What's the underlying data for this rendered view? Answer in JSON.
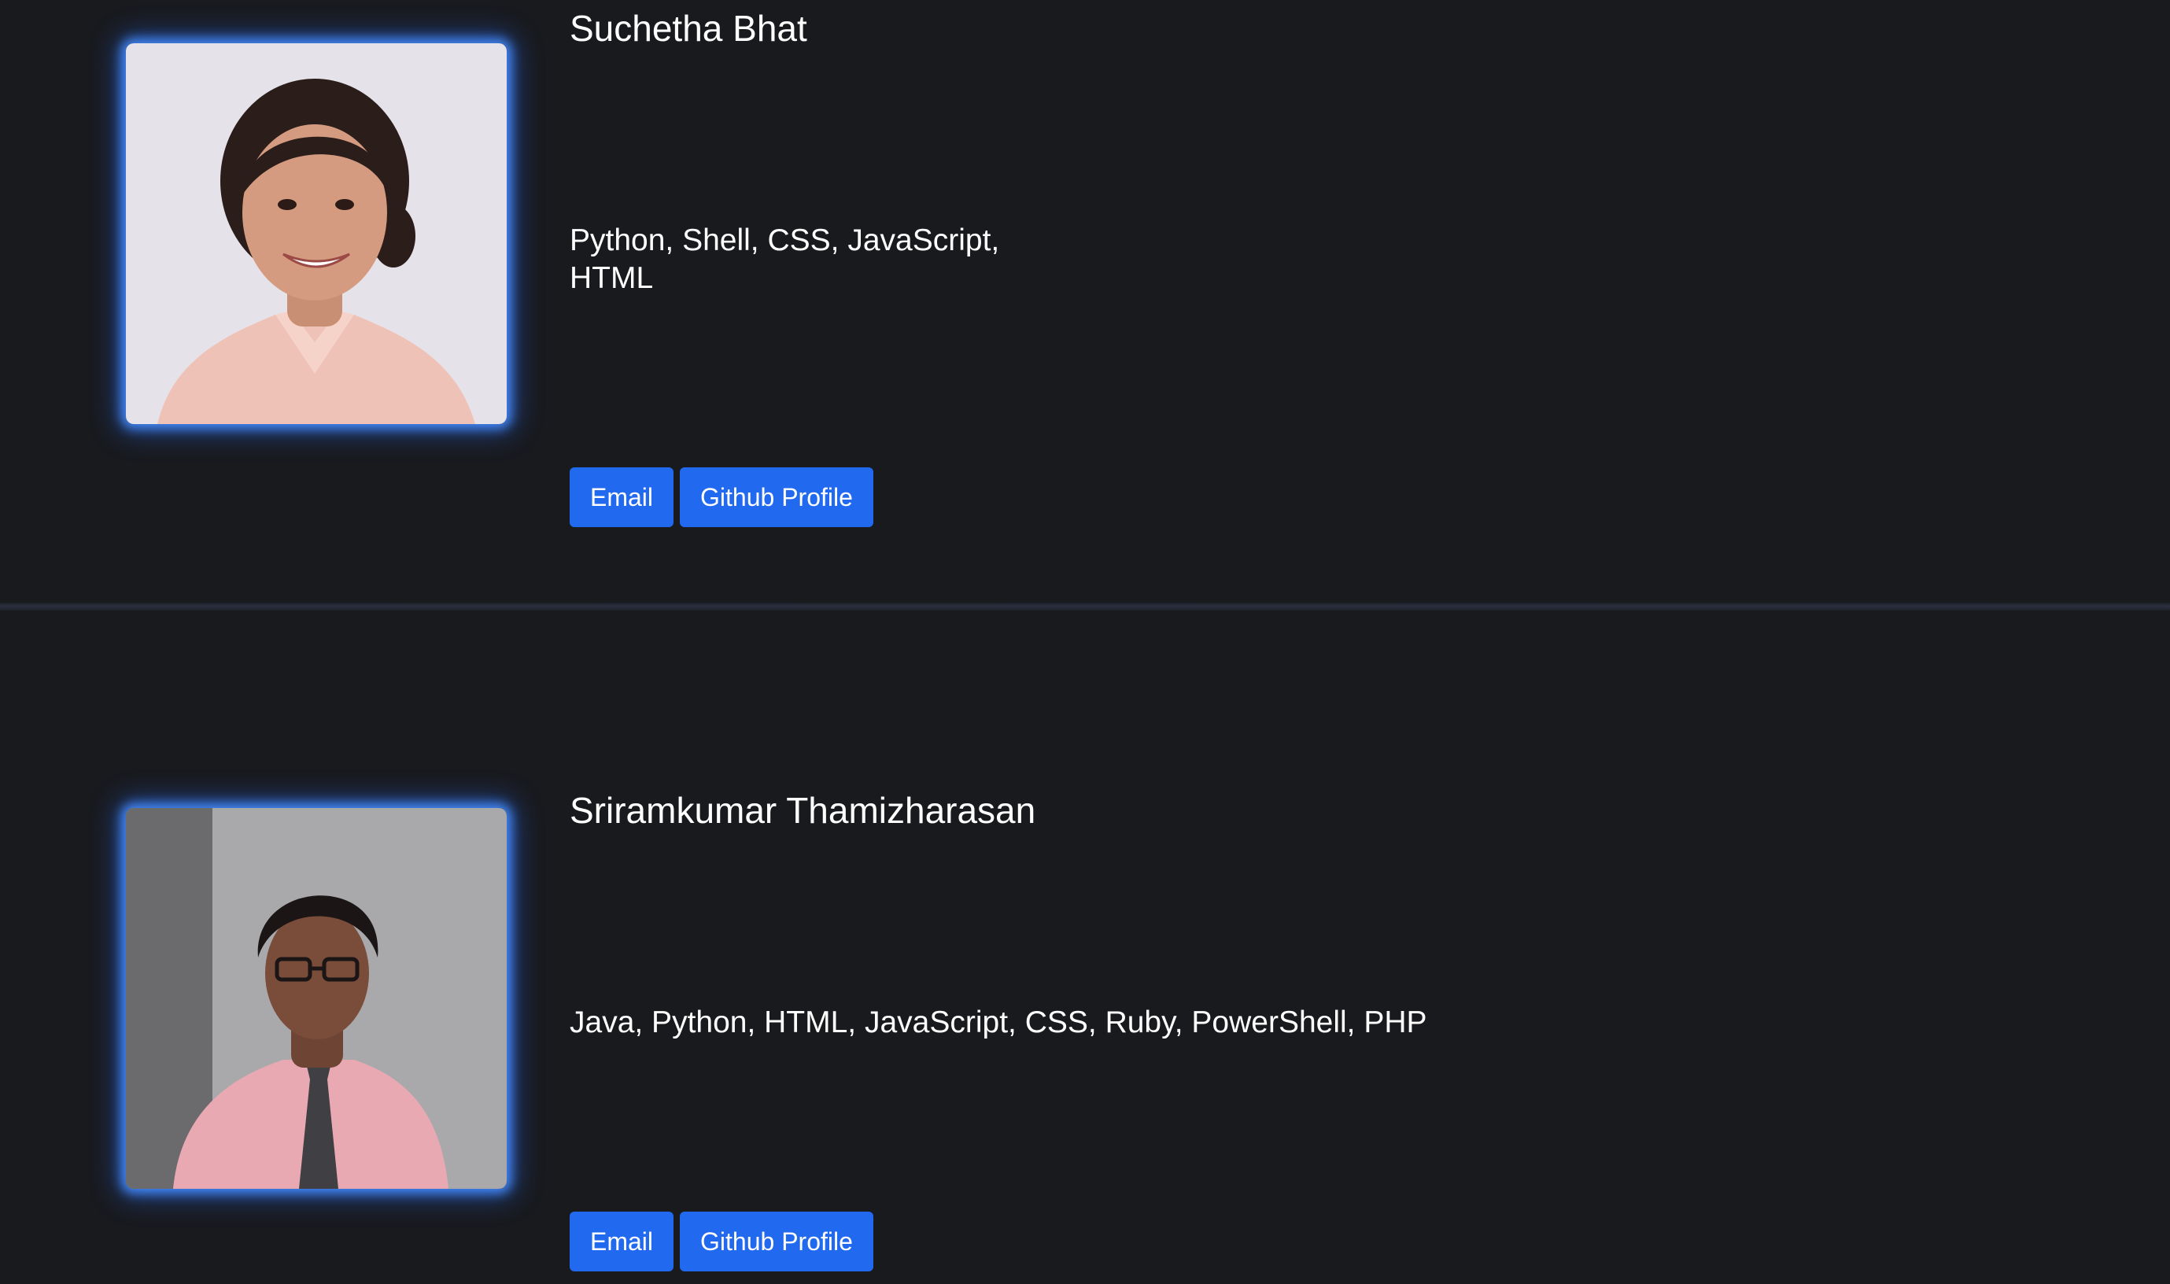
{
  "members": [
    {
      "name": "Suchetha Bhat",
      "languages": "Python, Shell, CSS, JavaScript, HTML",
      "email_label": "Email",
      "github_label": "Github Profile"
    },
    {
      "name": "Sriramkumar Thamizharasan",
      "languages": "Java, Python, HTML, JavaScript, CSS, Ruby, PowerShell, PHP",
      "email_label": "Email",
      "github_label": "Github Profile"
    }
  ],
  "colors": {
    "background": "#191a1e",
    "button": "#2169ee",
    "photo_glow": "#468cff",
    "text": "#ffffff"
  }
}
